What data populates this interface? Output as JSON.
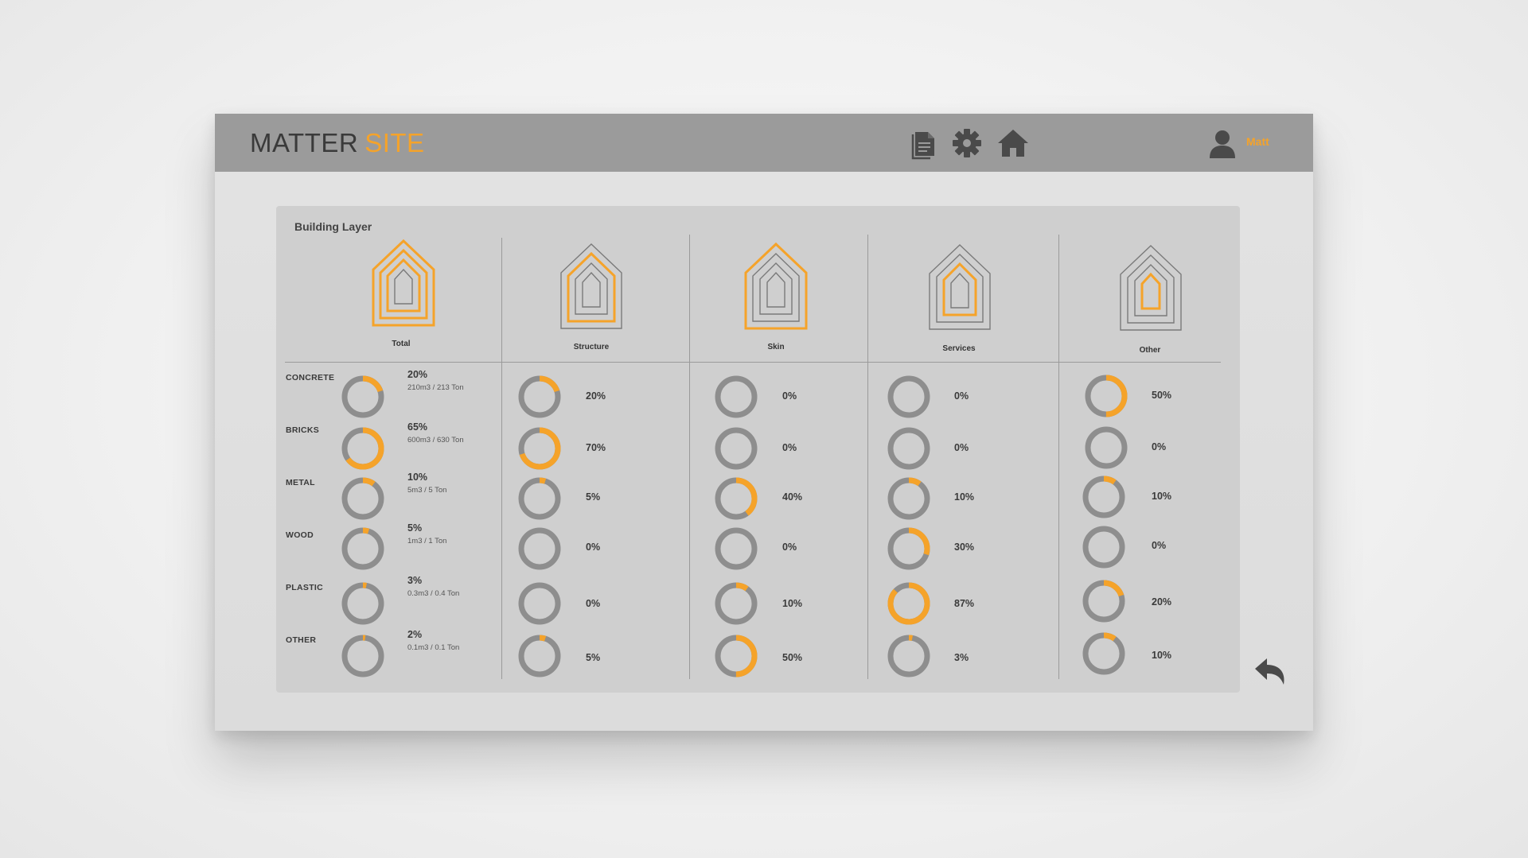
{
  "app": {
    "brand_part1": "MATTER",
    "brand_part2": "SITE",
    "user_name": "Matt"
  },
  "header_icons": [
    "document-icon",
    "gear-icon",
    "home-icon",
    "user-icon"
  ],
  "colors": {
    "accent": "#f5a32a",
    "ring_gray": "#8e8e8e",
    "header_bg": "#9b9b9b",
    "panel_bg": "#cfcfcf"
  },
  "panel": {
    "title": "Building Layer"
  },
  "layers": [
    {
      "label": "Total",
      "highlight_rings": [
        0,
        1,
        2
      ]
    },
    {
      "label": "Structure",
      "highlight_rings": [
        1
      ]
    },
    {
      "label": "Skin",
      "highlight_rings": [
        0
      ]
    },
    {
      "label": "Services",
      "highlight_rings": [
        2
      ]
    },
    {
      "label": "Other",
      "highlight_rings": [
        3
      ]
    }
  ],
  "materials": [
    "CONCRETE",
    "BRICKS",
    "METAL",
    "WOOD",
    "PLASTIC",
    "OTHER"
  ],
  "totals": [
    {
      "pct": "20%",
      "detail": "210m3 / 213 Ton",
      "value": 20
    },
    {
      "pct": "65%",
      "detail": "600m3 / 630 Ton",
      "value": 65
    },
    {
      "pct": "10%",
      "detail": "5m3 / 5 Ton",
      "value": 10
    },
    {
      "pct": "5%",
      "detail": "1m3 / 1 Ton",
      "value": 5
    },
    {
      "pct": "3%",
      "detail": "0.3m3 / 0.4 Ton",
      "value": 3
    },
    {
      "pct": "2%",
      "detail": "0.1m3 / 0.1 Ton",
      "value": 2
    }
  ],
  "columns": [
    {
      "layer": "Structure",
      "cells": [
        {
          "pct": "20%",
          "value": 20
        },
        {
          "pct": "70%",
          "value": 70
        },
        {
          "pct": "5%",
          "value": 5
        },
        {
          "pct": "0%",
          "value": 0
        },
        {
          "pct": "0%",
          "value": 0
        },
        {
          "pct": "5%",
          "value": 5
        }
      ]
    },
    {
      "layer": "Skin",
      "cells": [
        {
          "pct": "0%",
          "value": 0
        },
        {
          "pct": "0%",
          "value": 0
        },
        {
          "pct": "40%",
          "value": 40
        },
        {
          "pct": "0%",
          "value": 0
        },
        {
          "pct": "10%",
          "value": 10
        },
        {
          "pct": "50%",
          "value": 50
        }
      ]
    },
    {
      "layer": "Services",
      "cells": [
        {
          "pct": "0%",
          "value": 0
        },
        {
          "pct": "0%",
          "value": 0
        },
        {
          "pct": "10%",
          "value": 10
        },
        {
          "pct": "30%",
          "value": 30
        },
        {
          "pct": "87%",
          "value": 87
        },
        {
          "pct": "3%",
          "value": 3
        }
      ]
    },
    {
      "layer": "Other",
      "cells": [
        {
          "pct": "50%",
          "value": 50
        },
        {
          "pct": "0%",
          "value": 0
        },
        {
          "pct": "10%",
          "value": 10
        },
        {
          "pct": "0%",
          "value": 0
        },
        {
          "pct": "20%",
          "value": 20
        },
        {
          "pct": "10%",
          "value": 10
        }
      ]
    }
  ]
}
